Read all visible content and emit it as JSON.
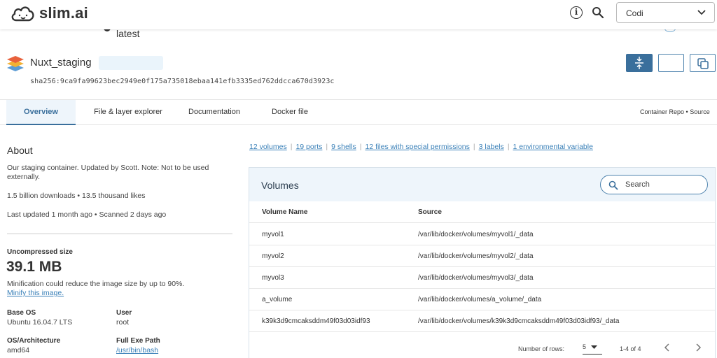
{
  "app": {
    "brand": "slim.ai",
    "user": "Codi"
  },
  "image": {
    "prev_tag": "latest",
    "name": "Nuxt_staging",
    "sha": "sha256:9ca9fa99623bec2949e0f175a735018ebaa141efb3335ed762ddcca670d3923c"
  },
  "tabs": [
    {
      "label": "Overview",
      "active": true
    },
    {
      "label": "File & layer explorer"
    },
    {
      "label": "Documentation"
    },
    {
      "label": "Docker file"
    }
  ],
  "repo_source": "Container Repo • Source",
  "about": {
    "title": "About",
    "description": "Our staging container. Updated by Scott. Note: Not to be used externally.",
    "stats": "1.5 billion downloads  •  13.5 thousand likes",
    "updated": "Last updated 1 month ago  •  Scanned 2 days ago"
  },
  "size": {
    "label": "Uncompressed size",
    "value": "39.1 MB",
    "note": "Minification could reduce the image size by up to 90%.",
    "link": "Minify this image."
  },
  "details": {
    "base_os_label": "Base OS",
    "base_os": "Ubuntu 16.04.7 LTS",
    "user_label": "User",
    "user": "root",
    "arch_label": "OS/Architecture",
    "arch": "amd64",
    "exe_label": "Full Exe Path",
    "exe": "/usr/bin/bash"
  },
  "summary_links": [
    "12 volumes",
    "19 ports",
    "9 shells",
    "12 files with special permissions",
    "3 labels",
    "1 environmental variable"
  ],
  "volumes": {
    "title": "Volumes",
    "search_placeholder": "Search",
    "columns": [
      "Volume Name",
      "Source"
    ],
    "rows": [
      [
        "myvol1",
        "/var/lib/docker/volumes/myvol1/_data"
      ],
      [
        "myvol2",
        "/var/lib/docker/volumes/myvol2/_data"
      ],
      [
        "myvol3",
        "/var/lib/docker/volumes/myvol3/_data"
      ],
      [
        "a_volume",
        "/var/lib/docker/volumes/a_volume/_data"
      ],
      [
        "k39k3d9cmcaksddm49f03d03idf93",
        "/var/lib/docker/volumes/k39k3d9cmcaksddm49f03d03idf93/_data"
      ]
    ],
    "rows_label": "Number of rows:",
    "rows_per_page": "5",
    "range": "1-4 of 4"
  },
  "colors": {
    "accent": "#3a6f9c",
    "link": "#3a80b8",
    "panel_header": "#eef5fb"
  },
  "icons": [
    "logo-cloud-icon",
    "info-icon",
    "search-icon",
    "chevron-down-icon",
    "layers-icon",
    "compress-icon",
    "copy-icon",
    "chevron-left-icon",
    "chevron-right-icon"
  ]
}
